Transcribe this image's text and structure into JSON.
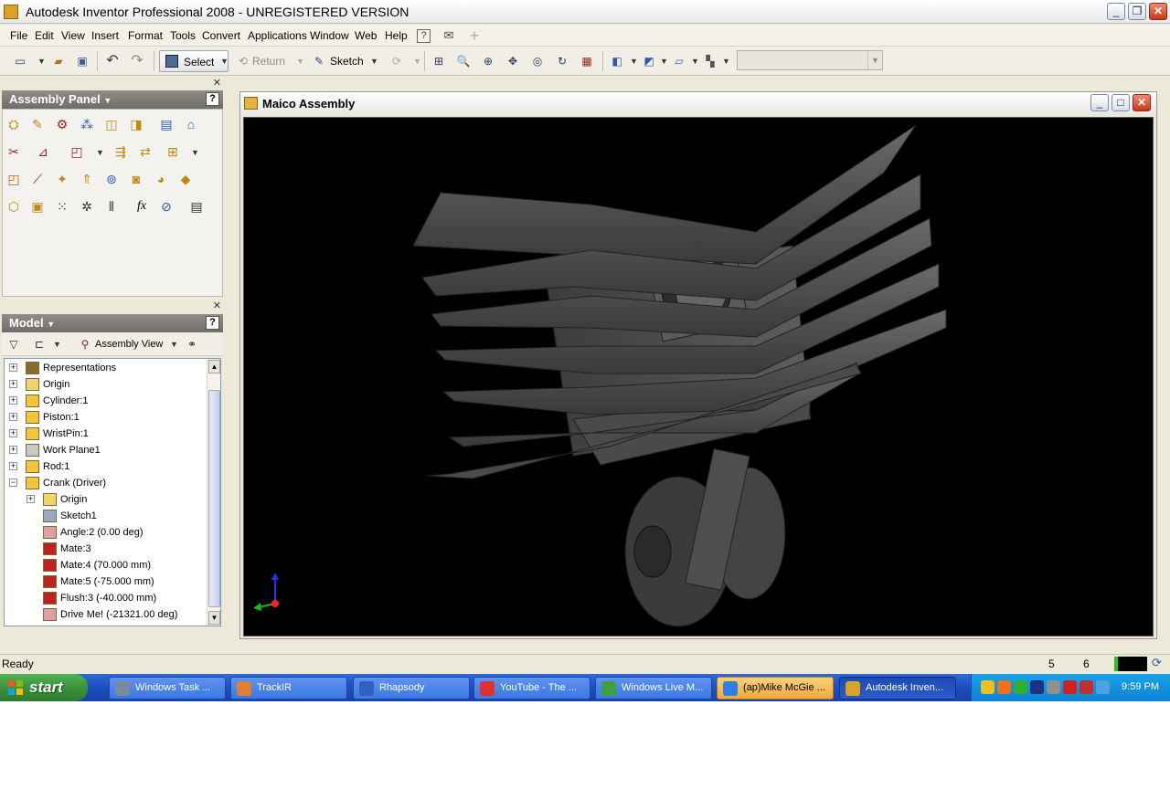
{
  "app": {
    "title": "Autodesk Inventor Professional 2008 - UNREGISTERED VERSION",
    "window_controls": [
      "minimize-icon",
      "restore-icon",
      "close-icon"
    ]
  },
  "menu": [
    "File",
    "Edit",
    "View",
    "Insert",
    "Format",
    "Tools",
    "Convert",
    "Applications",
    "Window",
    "Web",
    "Help"
  ],
  "toolbar": {
    "select_label": "Select",
    "return_label": "Return",
    "sketch_label": "Sketch"
  },
  "assembly_panel": {
    "title": "Assembly Panel"
  },
  "model_panel": {
    "title": "Model",
    "view_label": "Assembly View",
    "tree": [
      {
        "label": "Representations",
        "icon": "representations-icon",
        "expand": "+"
      },
      {
        "label": "Origin",
        "icon": "folder-icon",
        "expand": "+"
      },
      {
        "label": "Cylinder:1",
        "icon": "part-icon",
        "expand": "+"
      },
      {
        "label": "Piston:1",
        "icon": "part-icon",
        "expand": "+"
      },
      {
        "label": "WristPin:1",
        "icon": "part-icon",
        "expand": "+"
      },
      {
        "label": "Work Plane1",
        "icon": "workplane-icon",
        "expand": "+"
      },
      {
        "label": "Rod:1",
        "icon": "part-icon",
        "expand": "+"
      },
      {
        "label": "Crank (Driver)",
        "icon": "part-icon",
        "expand": "−"
      },
      {
        "label": "Origin",
        "icon": "folder-icon",
        "expand": "+"
      },
      {
        "label": "Sketch1",
        "icon": "sketch-icon",
        "expand": ""
      },
      {
        "label": "Angle:2 (0.00 deg)",
        "icon": "angle-constraint-icon",
        "expand": ""
      },
      {
        "label": "Mate:3",
        "icon": "mate-constraint-icon",
        "expand": ""
      },
      {
        "label": "Mate:4 (70.000 mm)",
        "icon": "mate-constraint-icon",
        "expand": ""
      },
      {
        "label": "Mate:5 (-75.000 mm)",
        "icon": "mate-constraint-icon",
        "expand": ""
      },
      {
        "label": "Flush:3 (-40.000 mm)",
        "icon": "flush-constraint-icon",
        "expand": ""
      },
      {
        "label": "Drive Me! (-21321.00 deg)",
        "icon": "angle-constraint-icon",
        "expand": ""
      }
    ]
  },
  "document": {
    "title": "Maico Assembly"
  },
  "status": {
    "text": "Ready",
    "num1": "5",
    "num2": "6"
  },
  "taskbar": {
    "start": "start",
    "tasks": [
      {
        "label": "Windows Task ...",
        "state": "normal"
      },
      {
        "label": "TrackIR",
        "state": "normal"
      },
      {
        "label": "Rhapsody",
        "state": "normal"
      },
      {
        "label": "YouTube - The ...",
        "state": "normal"
      },
      {
        "label": "Windows Live M...",
        "state": "normal"
      },
      {
        "label": "(ap)Mike McGie ...",
        "state": "flash"
      },
      {
        "label": "Autodesk Inven...",
        "state": "active"
      }
    ],
    "clock": "9:59 PM"
  },
  "colors": {
    "viewport_bg": "#000000",
    "panel_header": "#7d7c77",
    "taskbar": "#245edb",
    "start_button": "#3c9a3c"
  }
}
